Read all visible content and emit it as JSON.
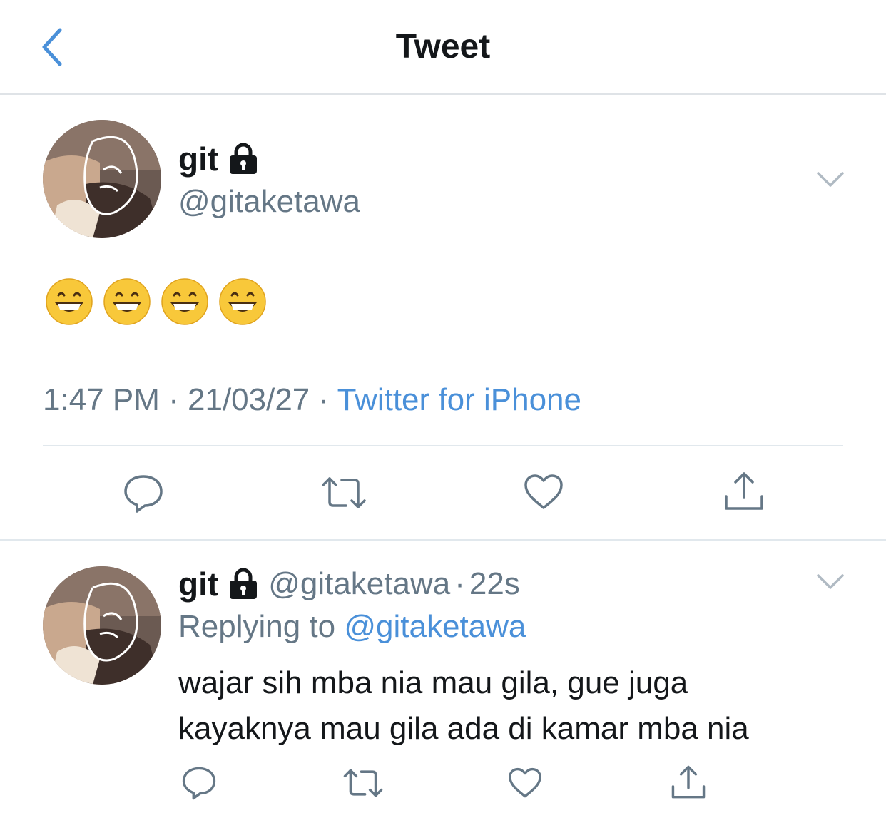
{
  "header": {
    "title": "Tweet",
    "back_icon": "chevron-left-icon"
  },
  "colors": {
    "accent": "#4a90d9",
    "secondary_text": "#657786",
    "primary_text": "#14171a",
    "divider": "#e1e8ed"
  },
  "tweet": {
    "display_name": "git",
    "protected_icon": "lock-icon",
    "handle": "@gitaketawa",
    "emojis": [
      "😁",
      "😁",
      "😁",
      "😁"
    ],
    "time": "1:47 PM",
    "date": "21/03/27",
    "separator": "·",
    "source": "Twitter for iPhone",
    "actions": [
      "reply-icon",
      "retweet-icon",
      "like-icon",
      "share-icon"
    ]
  },
  "reply": {
    "display_name": "git",
    "handle": "@gitaketawa",
    "dot": "·",
    "age": "22s",
    "replying_label": "Replying to",
    "replying_to": "@gitaketawa",
    "text": "wajar sih mba nia mau gila, gue juga kayaknya mau gila ada di kamar mba nia",
    "actions": [
      "reply-icon",
      "retweet-icon",
      "like-icon",
      "share-icon"
    ]
  }
}
